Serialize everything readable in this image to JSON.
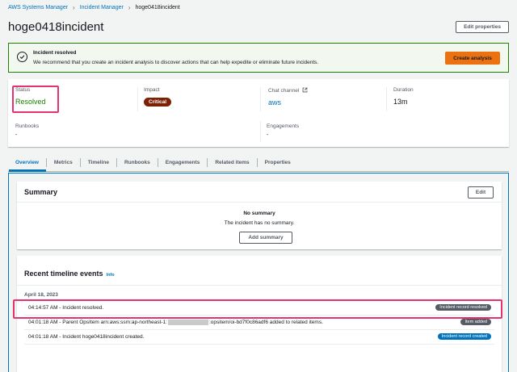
{
  "breadcrumb": {
    "items": [
      "AWS Systems Manager",
      "Incident Manager",
      "hoge0418incident"
    ]
  },
  "page": {
    "title": "hoge0418incident",
    "edit_properties_label": "Edit properties"
  },
  "flash": {
    "title": "Incident resolved",
    "message": "We recommend that you create an incident analysis to discover actions that can help expedite or eliminate future incidents.",
    "action_label": "Create analysis"
  },
  "details": {
    "status_label": "Status",
    "status_value": "Resolved",
    "impact_label": "Impact",
    "impact_value": "Critical",
    "chat_label": "Chat channel",
    "chat_value": "aws",
    "duration_label": "Duration",
    "duration_value": "13m",
    "runbooks_label": "Runbooks",
    "runbooks_value": "-",
    "engagements_label": "Engagements",
    "engagements_value": "-"
  },
  "tabs": [
    "Overview",
    "Metrics",
    "Timeline",
    "Runbooks",
    "Engagements",
    "Related items",
    "Properties"
  ],
  "summary": {
    "title": "Summary",
    "edit_label": "Edit",
    "empty_title": "No summary",
    "empty_message": "The incident has no summary.",
    "add_label": "Add summary"
  },
  "timeline": {
    "title": "Recent timeline events",
    "info_label": "Info",
    "date": "April 18, 2023",
    "events": [
      {
        "text": "04:14:57 AM  -  Incident resolved.",
        "badge": "Incident record resolved"
      },
      {
        "text_before": "04:01:18 AM  -  Parent OpsItem arn:aws:ssm:ap-northeast-1:",
        "text_after": ":opsitem/oi-bd7f0c86adf6 added to related items.",
        "badge": "Item added"
      },
      {
        "text": "04:01:18 AM  -  Incident hoge0418incident created.",
        "badge": "Incident record created"
      }
    ]
  },
  "colors": {
    "link": "#0073bb",
    "success": "#1d8102",
    "critical": "#7d2105",
    "primary_button": "#ec7211",
    "highlight": "#e6326e"
  }
}
